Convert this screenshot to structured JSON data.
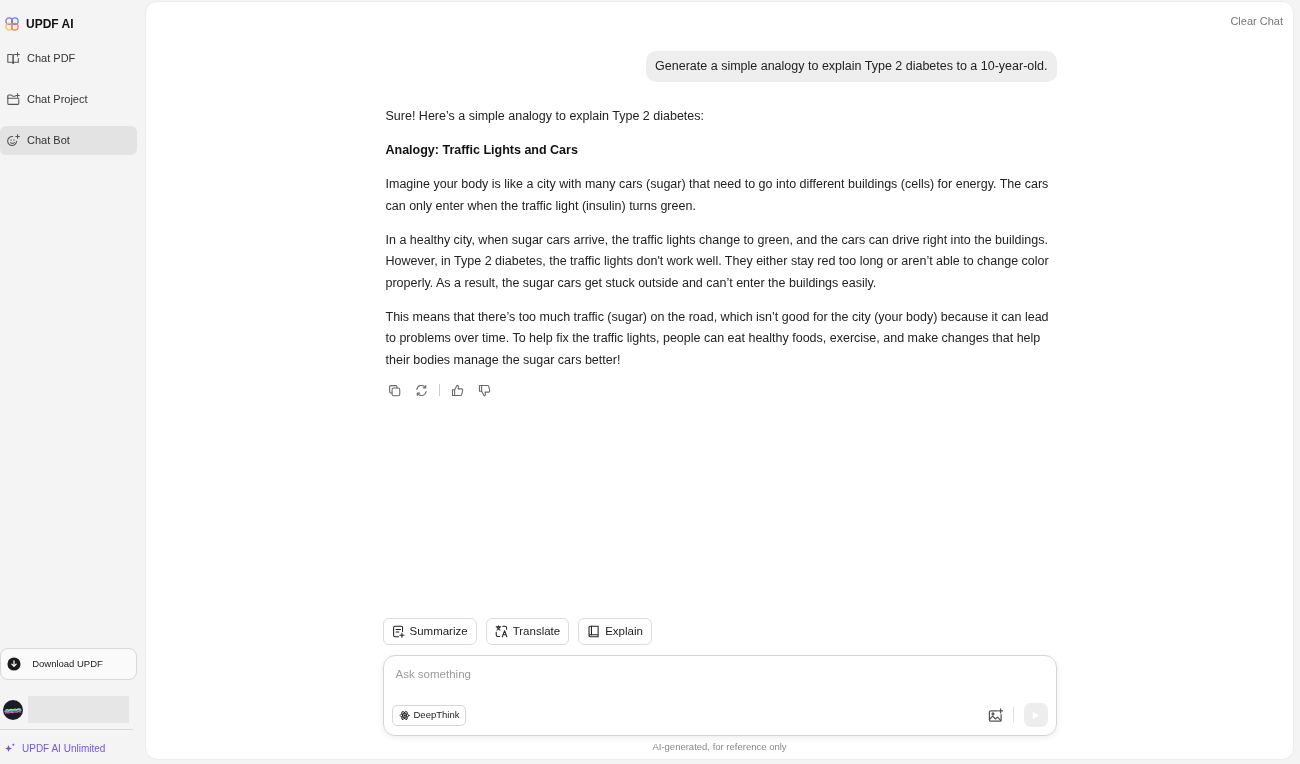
{
  "sidebar": {
    "brand": "UPDF AI",
    "nav_items": [
      {
        "label": "Chat PDF",
        "selected": false
      },
      {
        "label": "Chat Project",
        "selected": false
      },
      {
        "label": "Chat Bot",
        "selected": true
      }
    ],
    "download_button": "Download UPDF",
    "upgrade_link": "UPDF AI Unlimited"
  },
  "header": {
    "clear_button": "Clear Chat"
  },
  "messages": [
    {
      "kind": "question",
      "text": "Generate a simple analogy to explain Type 2 diabetes to a 10-year-old."
    },
    {
      "kind": "answer",
      "blocks": [
        {
          "kind": "paragraph",
          "text": "Sure! Here’s a simple analogy to explain Type 2 diabetes:"
        },
        {
          "kind": "heading",
          "text": "Analogy: Traffic Lights and Cars"
        },
        {
          "kind": "paragraph",
          "text": "Imagine your body is like a city with many cars (sugar) that need to go into different buildings (cells) for energy. The cars can only enter when the traffic light (insulin) turns green."
        },
        {
          "kind": "paragraph",
          "text": "In a healthy city, when sugar cars arrive, the traffic lights change to green, and the cars can drive right into the buildings. However, in Type 2 diabetes, the traffic lights don't work well. They either stay red too long or aren’t able to change color properly. As a result, the sugar cars get stuck outside and can’t enter the buildings easily."
        },
        {
          "kind": "paragraph",
          "text": "This means that there’s too much traffic (sugar) on the road, which isn’t good for the city (your body) because it can lead to problems over time. To help fix the traffic lights, people can eat healthy foods, exercise, and make changes that help their bodies manage the sugar cars better!"
        }
      ]
    }
  ],
  "quick_actions": [
    "Summarize",
    "Translate",
    "Explain"
  ],
  "composer": {
    "placeholder": "Ask something",
    "deepthink_button": "DeepThink",
    "send_button": {
      "disabled": true
    }
  },
  "footnote": "AI-generated, for reference only"
}
